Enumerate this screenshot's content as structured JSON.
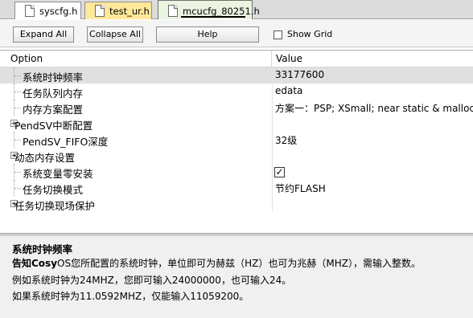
{
  "tabs": [
    {
      "label": "syscfg.h"
    },
    {
      "label": "test_ur.h"
    },
    {
      "label": "mcucfg_80251.h"
    }
  ],
  "toolbar": {
    "expand_all": "Expand All",
    "collapse_all": "Collapse All",
    "help": "Help",
    "show_grid": "Show Grid",
    "show_grid_checked": false
  },
  "grid": {
    "headers": {
      "option": "Option",
      "value": "Value"
    },
    "rows": [
      {
        "name": "系统时钟频率",
        "value": "33177600",
        "expandable": false,
        "selected": true
      },
      {
        "name": "任务队列内存",
        "value": "edata",
        "expandable": false
      },
      {
        "name": "内存方案配置",
        "value": "方案一：PSP; XSmall; near static & malloc",
        "expandable": false
      },
      {
        "name": "PendSV中断配置",
        "value": "",
        "expandable": true
      },
      {
        "name": "PendSV_FIFO深度",
        "value": "32级",
        "expandable": false
      },
      {
        "name": "动态内存设置",
        "value": "",
        "expandable": true
      },
      {
        "name": "系统变量零安装",
        "value": "",
        "expandable": false,
        "checkbox": true,
        "checked": true
      },
      {
        "name": "任务切换模式",
        "value": "节约FLASH",
        "expandable": false
      },
      {
        "name": "任务切换现场保护",
        "value": "",
        "expandable": true
      }
    ]
  },
  "description": {
    "title": "系统时钟频率",
    "line1_bold": "告知Cosy",
    "line1_rest": "OS您所配置的系统时钟，单位即可为赫兹（HZ）也可为兆赫（MHZ），需输入整数。",
    "line2": "例如系统时钟为24MHZ，您即可输入24000000，也可输入24。",
    "line3": "如果系统时钟为11.0592MHZ，仅能输入11059200。"
  }
}
